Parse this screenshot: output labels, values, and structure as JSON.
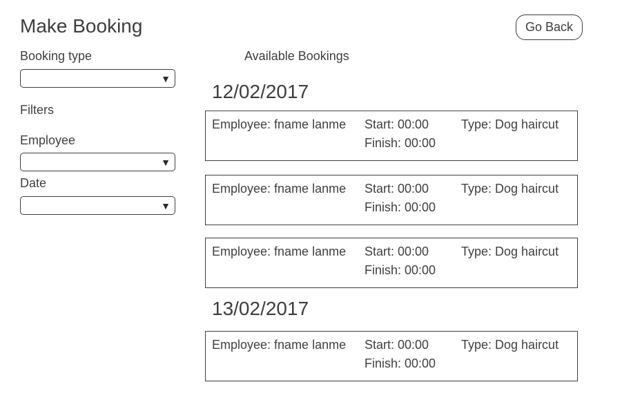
{
  "page": {
    "title": "Make Booking",
    "back_label": "Go Back"
  },
  "sidebar": {
    "booking_type_label": "Booking type",
    "booking_type_value": "",
    "filters_label": "Filters",
    "employee_label": "Employee",
    "employee_value": "",
    "date_label": "Date",
    "date_value": "",
    "dropdown_arrow": "▼"
  },
  "main": {
    "section_title": "Available Bookings",
    "groups": [
      {
        "date": "12/02/2017",
        "bookings": [
          {
            "employee": "Employee: fname lanme",
            "start": "Start: 00:00",
            "finish": "Finish: 00:00",
            "type": "Type: Dog haircut"
          },
          {
            "employee": "Employee: fname lanme",
            "start": "Start: 00:00",
            "finish": "Finish: 00:00",
            "type": "Type: Dog haircut"
          },
          {
            "employee": "Employee: fname lanme",
            "start": "Start: 00:00",
            "finish": "Finish: 00:00",
            "type": "Type: Dog haircut"
          }
        ]
      },
      {
        "date": "13/02/2017",
        "bookings": [
          {
            "employee": "Employee: fname lanme",
            "start": "Start: 00:00",
            "finish": "Finish: 00:00",
            "type": "Type: Dog haircut"
          }
        ]
      }
    ]
  }
}
